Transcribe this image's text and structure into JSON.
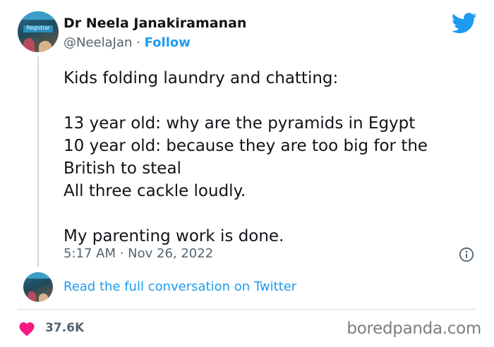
{
  "author": {
    "name": "Dr Neela Janakiramanan",
    "handle": "@NeelaJan",
    "separator": "·",
    "follow_label": "Follow",
    "avatar_sign_text": "Registrar"
  },
  "tweet": {
    "lines": [
      "Kids folding laundry and chatting:",
      "",
      "13 year old: why are the pyramids in Egypt",
      "10 year old: because they are too big for the",
      "British to steal",
      "All three cackle loudly.",
      "",
      "My parenting work is done."
    ],
    "timestamp": "5:17 AM · Nov 26, 2022"
  },
  "conversation_link": "Read the full conversation on Twitter",
  "engagement": {
    "likes": "37.6K"
  },
  "watermark": "boredpanda.com",
  "icons": {
    "twitter": "twitter-bird-icon",
    "info": "info-icon",
    "heart": "heart-icon"
  },
  "colors": {
    "accent": "#1d9bf0",
    "heart": "#f91880",
    "secondary_text": "#536471"
  }
}
